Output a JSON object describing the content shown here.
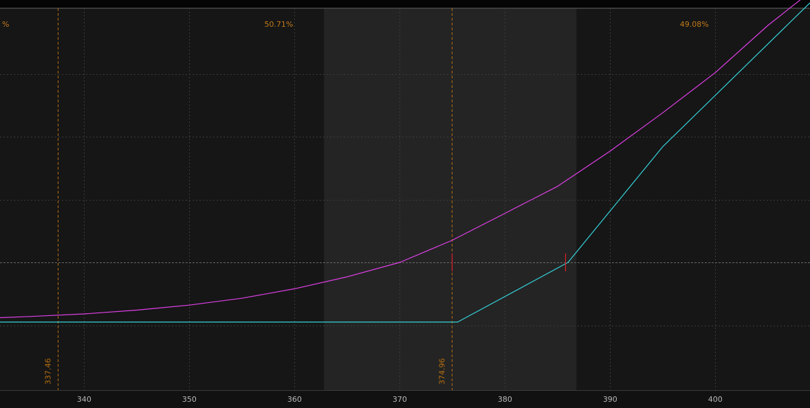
{
  "chart_data": {
    "type": "line",
    "xlim": [
      332,
      409
    ],
    "x_ticks": [
      340,
      350,
      360,
      370,
      380,
      390,
      400
    ],
    "x_tick_labels": [
      "340",
      "350",
      "360",
      "370",
      "380",
      "390",
      "400"
    ],
    "shaded_range": [
      362.8,
      386.8
    ],
    "zero_level": 0,
    "y_levels": [
      -1,
      0,
      1,
      2,
      3
    ],
    "grid": true,
    "probability_labels": [
      {
        "text": "%",
        "x": 332.2
      },
      {
        "text": "50.71%",
        "x": 358.5
      },
      {
        "text": "49.08%",
        "x": 398
      }
    ],
    "vertical_markers": [
      {
        "x": 337.46,
        "label": "337.46"
      },
      {
        "x": 374.96,
        "label": "374.96"
      }
    ],
    "breakeven_marks": [
      374.96,
      385.7
    ],
    "series": [
      {
        "color": "#e040e8",
        "x": [
          332,
          335,
          340,
          345,
          350,
          355,
          360,
          365,
          370,
          374.96,
          380,
          385,
          390,
          395,
          400,
          405,
          409
        ],
        "y": [
          -0.88,
          -0.86,
          -0.82,
          -0.76,
          -0.68,
          -0.57,
          -0.42,
          -0.23,
          0.0,
          0.35,
          0.78,
          1.21,
          1.77,
          2.38,
          3.02,
          3.77,
          4.3
        ]
      },
      {
        "color": "#35d4dc",
        "x": [
          332,
          374.96,
          375.5,
          386,
          395,
          409
        ],
        "y": [
          -0.95,
          -0.95,
          -0.95,
          0.0,
          1.84,
          4.13
        ]
      }
    ]
  }
}
